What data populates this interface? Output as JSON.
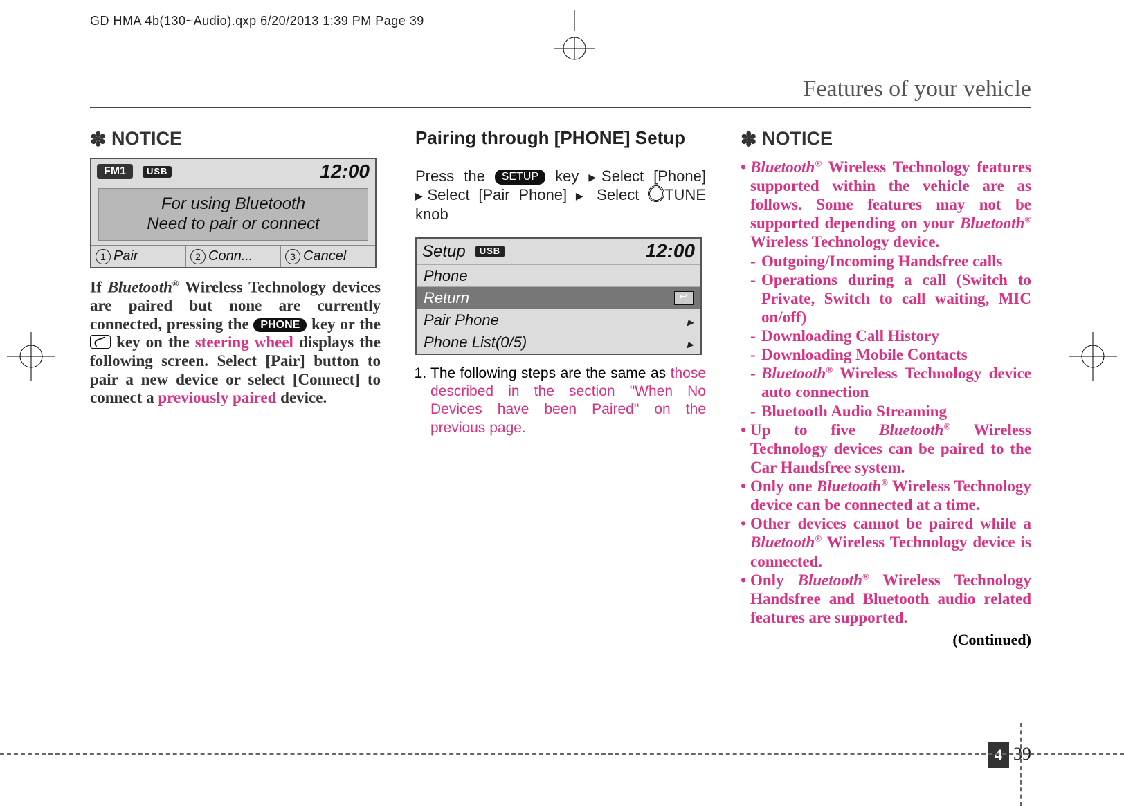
{
  "slug": "GD HMA 4b(130~Audio).qxp   6/20/2013   1:39 PM   Page 39",
  "header_title": "Features of your vehicle",
  "col1": {
    "notice_label": "NOTICE",
    "lcd1": {
      "mode": "FM1",
      "badge": "USB",
      "clock": "12:00",
      "line1": "For using Bluetooth",
      "line2": "Need to pair or connect",
      "opt1": "Pair",
      "opt2": "Conn...",
      "opt3": "Cancel"
    },
    "para_pre": "If ",
    "bt": "Bluetooth",
    "reg": "®",
    "para_mid1": "  Wireless Technology devices are paired but none are cur­rently connected, pressing the ",
    "phone_key": "PHONE",
    "para_mid2": " key or the ",
    "para_mid3": " key on the ",
    "steering": "steering wheel",
    "para_mid4": " displays the following screen. Select [Pair] button to pair a new device or select [Connect] to connect a ",
    "prev_paired": "previously paired",
    "para_end": " device."
  },
  "col2": {
    "heading": "Pairing through [PHONE] Setup",
    "p1_a": "Press the ",
    "setup_key": "SETUP",
    "p1_b": " key ",
    "p1_c": "Select [Phone]",
    "p1_d": "Select [Pair Phone] ",
    "p1_e": "Select ",
    "p1_f": "TUNE knob",
    "lcd2": {
      "title": "Setup",
      "badge": "USB",
      "clock": "12:00",
      "r1": "Phone",
      "r2": "Return",
      "r3": "Pair Phone",
      "r4": "Phone List(0/5)"
    },
    "step1_a": "The following steps are the same as ",
    "step1_b": "those described in the section \"When No Devices have been Paired\" on the previous page."
  },
  "col3": {
    "notice_label": "NOTICE",
    "bt": "Bluetooth",
    "reg": "®",
    "li1_a": " Wireless Technology features supported within the vehi­cle are as follows. Some features may not be supported depending on your ",
    "li1_b": " Wireless Technology device.",
    "s1": "Outgoing/Incoming Handsfree calls",
    "s2": "Operations during a call (Switch to Private, Switch to call waiting, MIC on/off)",
    "s3": "Downloading Call History",
    "s4": "Downloading Mobile Contacts",
    "s5_b": " Wireless Technology device auto connection",
    "s6": "Bluetooth Audio Streaming",
    "li2_a": "Up to five ",
    "li2_b": " Wireless Technology devices can be paired to the Car Handsfree system.",
    "li3_a": "Only one ",
    "li3_b": " Wireless Technology device can be connect­ed at a time.",
    "li4_a": "Other devices cannot be paired while a ",
    "li4_b": " Wireless Technology device is connected.",
    "li5_a": "Only ",
    "li5_b": " Wireless Technology Handsfree and Bluetooth audio related features are supported.",
    "continued": "(Continued)"
  },
  "page_section": "4",
  "page_num": "39"
}
